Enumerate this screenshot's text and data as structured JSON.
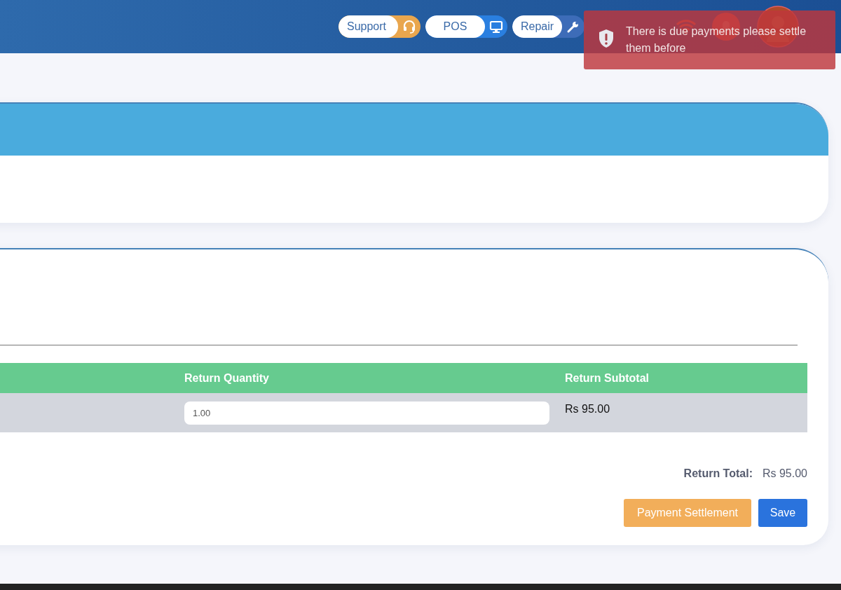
{
  "header": {
    "pills": [
      {
        "label": "Support",
        "kind": "support"
      },
      {
        "label": "POS",
        "kind": "pos"
      },
      {
        "label": "Repair",
        "kind": "repair"
      }
    ]
  },
  "toast": {
    "message": "There is due payments please settle them before"
  },
  "table": {
    "columns": [
      "Return Quantity",
      "Return Subtotal"
    ],
    "rows": [
      {
        "quantity": "1.00",
        "subtotal": "Rs 95.00"
      }
    ]
  },
  "summary": {
    "label": "Return Total:",
    "value": "Rs 95.00"
  },
  "buttons": [
    {
      "label": "Payment Settlement",
      "kind": "warning"
    },
    {
      "label": "Save",
      "kind": "primary"
    }
  ]
}
